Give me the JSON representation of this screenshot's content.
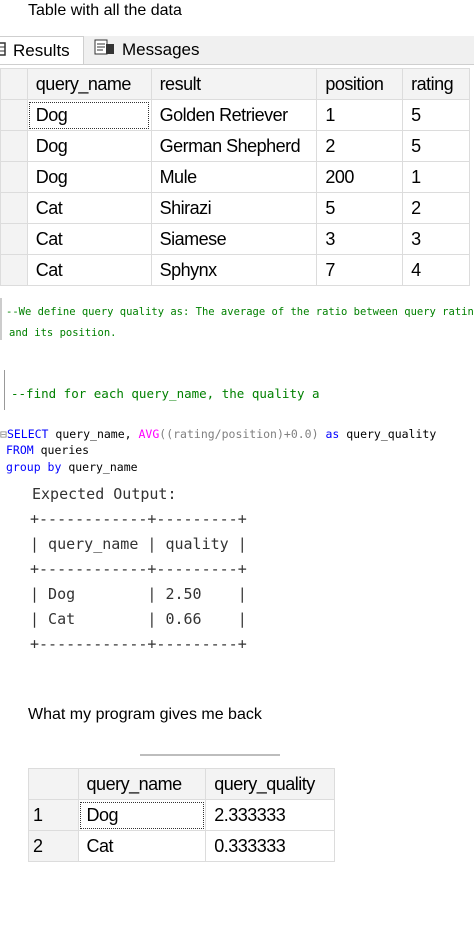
{
  "captions": {
    "top": "Table with all the data",
    "bottom": "What my program gives me back"
  },
  "tabs": [
    {
      "label": "Results",
      "icon": "grid-icon"
    },
    {
      "label": "Messages",
      "icon": "messages-icon"
    }
  ],
  "results_table": {
    "columns": [
      "query_name",
      "result",
      "position",
      "rating"
    ],
    "rows": [
      [
        "Dog",
        "Golden Retriever",
        "1",
        "5"
      ],
      [
        "Dog",
        "German Shepherd",
        "2",
        "5"
      ],
      [
        "Dog",
        "Mule",
        "200",
        "1"
      ],
      [
        "Cat",
        "Shirazi",
        "5",
        "2"
      ],
      [
        "Cat",
        "Siamese",
        "3",
        "3"
      ],
      [
        "Cat",
        "Sphynx",
        "7",
        "4"
      ]
    ]
  },
  "comments": {
    "definition_line1": "--We define query quality as: The average of the ratio between query rating",
    "definition_line2": "and its position.",
    "find": "--find for each query_name, the quality a"
  },
  "sql": {
    "line1": {
      "kw1": "SELECT",
      "t1": " query_name, ",
      "fn": "AVG",
      "t2": "((rating/position)+0.0) ",
      "kw2": "as",
      "t3": " query_quality"
    },
    "line2": {
      "kw": "FROM",
      "t": " queries"
    },
    "line3": {
      "kw": "group by",
      "t": " query_name"
    }
  },
  "expected": {
    "title": "Expected Output:",
    "border": "+------------+---------+",
    "header": "| query_name | quality |",
    "row1": "| Dog        | 2.50    |",
    "row2": "| Cat        | 0.66    |"
  },
  "output_table": {
    "columns": [
      "query_name",
      "query_quality"
    ],
    "rows": [
      [
        "1",
        "Dog",
        "2.333333"
      ],
      [
        "2",
        "Cat",
        "0.333333"
      ]
    ]
  }
}
